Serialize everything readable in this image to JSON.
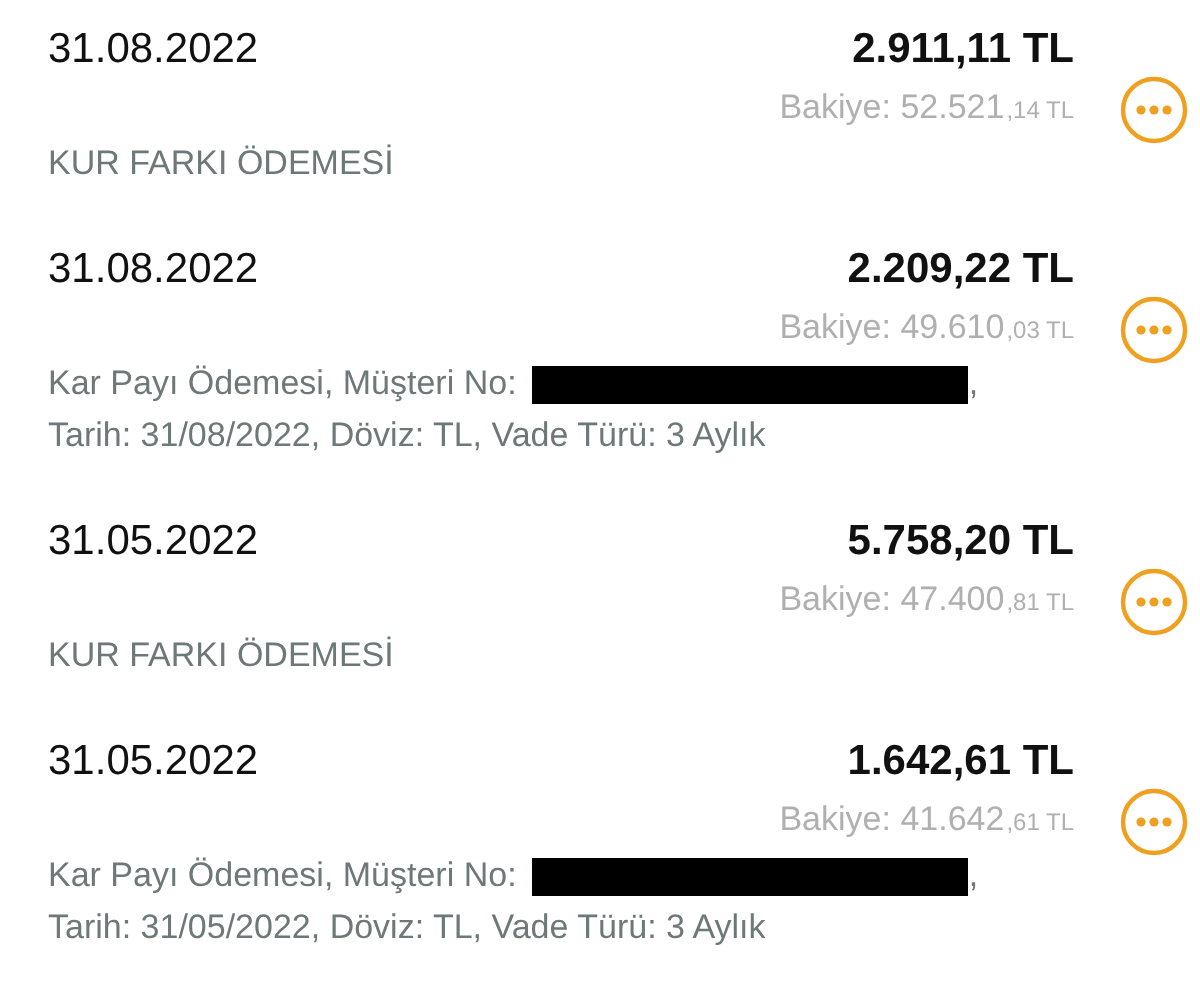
{
  "transactions": [
    {
      "kind": "plain",
      "date": "31.08.2022",
      "amount": "2.911,11 TL",
      "balance": "Bakiye: 52.521",
      "balance_cents": ",14 TL",
      "description": "KUR FARKI ÖDEMESİ"
    },
    {
      "kind": "redacted",
      "date": "31.08.2022",
      "amount": "2.209,22 TL",
      "balance": "Bakiye: 49.610",
      "balance_cents": ",03 TL",
      "description": "Kar Payı Ödemesi, Müşteri No:",
      "after_redaction": ",",
      "description_line_2": "Tarih: 31/08/2022, Döviz: TL, Vade Türü: 3 Aylık"
    },
    {
      "kind": "plain",
      "date": "31.05.2022",
      "amount": "5.758,20 TL",
      "balance": "Bakiye: 47.400",
      "balance_cents": ",81 TL",
      "description": "KUR FARKI ÖDEMESİ"
    },
    {
      "kind": "redacted",
      "date": "31.05.2022",
      "amount": "1.642,61 TL",
      "balance": "Bakiye: 41.642",
      "balance_cents": ",61 TL",
      "description": "Kar Payı Ödemesi, Müşteri No:",
      "after_redaction": ",",
      "description_line_2": "Tarih: 31/05/2022, Döviz: TL, Vade Türü: 3 Aylık"
    }
  ]
}
